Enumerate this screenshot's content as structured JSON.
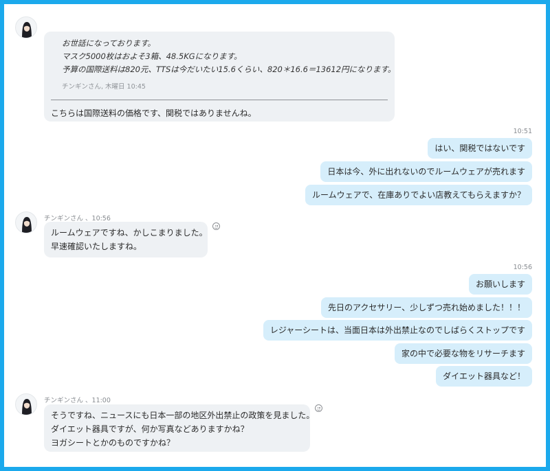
{
  "messages": {
    "m1": {
      "quote_lines": [
        "お世話になっております。",
        "マスク5000枚はおよそ3箱、48.5KGになります。",
        "予算の国際送料は820元、TTSは今だいたい15.6くらい、820＊16.6＝13612円になります。"
      ],
      "quote_meta": "チンギンさん, 木曜日 10:45",
      "text": "こちらは国際送料の価格です、関税ではありませんね。"
    },
    "g2": {
      "time": "10:51",
      "items": [
        "はい、関税ではないです",
        "日本は今、外に出れないのでルームウェアが売れます",
        "ルームウェアで、在庫ありでよい店教えてもらえますか？"
      ]
    },
    "m3": {
      "meta": "チンギンさん 、10:56",
      "lines": [
        "ルームウェアですね、かしこまりました。",
        "早速確認いたしますね。"
      ]
    },
    "g4": {
      "time": "10:56",
      "items": [
        "お願いします",
        "先日のアクセサリー、少しずつ売れ始めました！！！",
        "レジャーシートは、当面日本は外出禁止なのでしばらくストップです",
        "家の中で必要な物をリサーチます",
        "ダイエット器具など！"
      ]
    },
    "m5": {
      "meta": "チンギンさん 、11:00",
      "lines": [
        "そうですね、ニュースにも日本一部の地区外出禁止の政策を見ました。",
        "ダイエット器具ですが、何か写真などありますかね？",
        "ヨガシートとかのものですかね？"
      ]
    }
  },
  "icons": {
    "avatar": "avatar-icon",
    "emoji": "emoji-icon"
  },
  "colors": {
    "frame": "#1ba9ec",
    "incoming_bubble": "#eef1f4",
    "outgoing_bubble": "#d6eefb"
  }
}
